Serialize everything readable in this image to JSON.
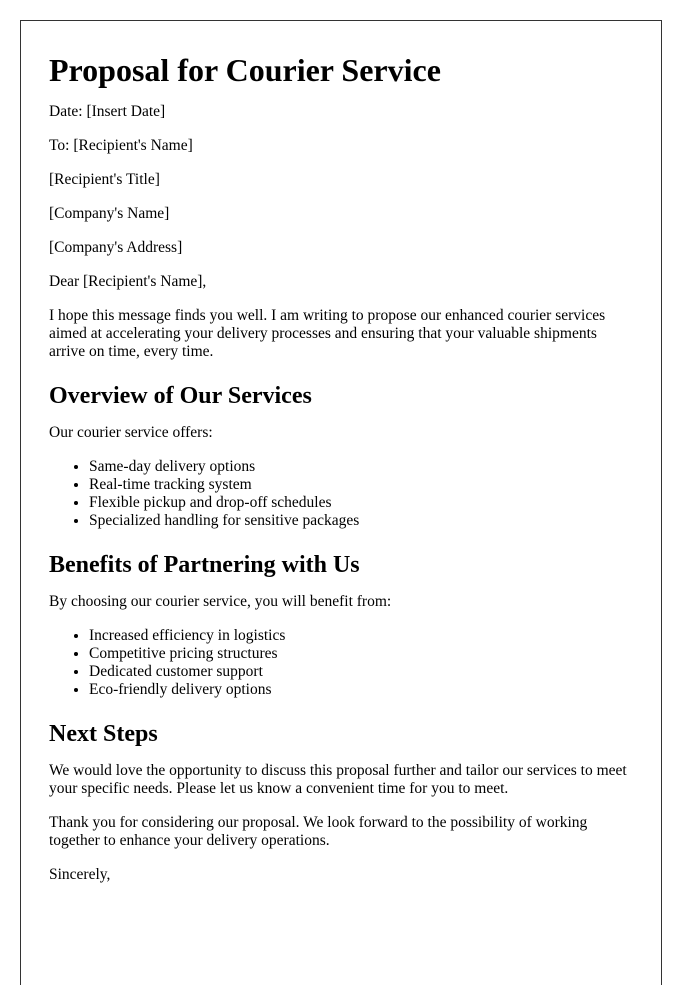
{
  "title": "Proposal for Courier Service",
  "header_lines": {
    "date": "Date: [Insert Date]",
    "to": "To: [Recipient's Name]",
    "recipient_title": "[Recipient's Title]",
    "company_name": "[Company's Name]",
    "company_address": "[Company's Address]"
  },
  "salutation": "Dear [Recipient's Name],",
  "intro": "I hope this message finds you well. I am writing to propose our enhanced courier services aimed at accelerating your delivery processes and ensuring that your valuable shipments arrive on time, every time.",
  "sections": [
    {
      "heading": "Overview of Our Services",
      "lead": "Our courier service offers:",
      "items": [
        "Same-day delivery options",
        "Real-time tracking system",
        "Flexible pickup and drop-off schedules",
        "Specialized handling for sensitive packages"
      ]
    },
    {
      "heading": "Benefits of Partnering with Us",
      "lead": "By choosing our courier service, you will benefit from:",
      "items": [
        "Increased efficiency in logistics",
        "Competitive pricing structures",
        "Dedicated customer support",
        "Eco-friendly delivery options"
      ]
    },
    {
      "heading": "Next Steps",
      "paragraphs": [
        "We would love the opportunity to discuss this proposal further and tailor our services to meet your specific needs. Please let us know a convenient time for you to meet.",
        "Thank you for considering our proposal. We look forward to the possibility of working together to enhance your delivery operations."
      ]
    }
  ],
  "closing": "Sincerely,"
}
